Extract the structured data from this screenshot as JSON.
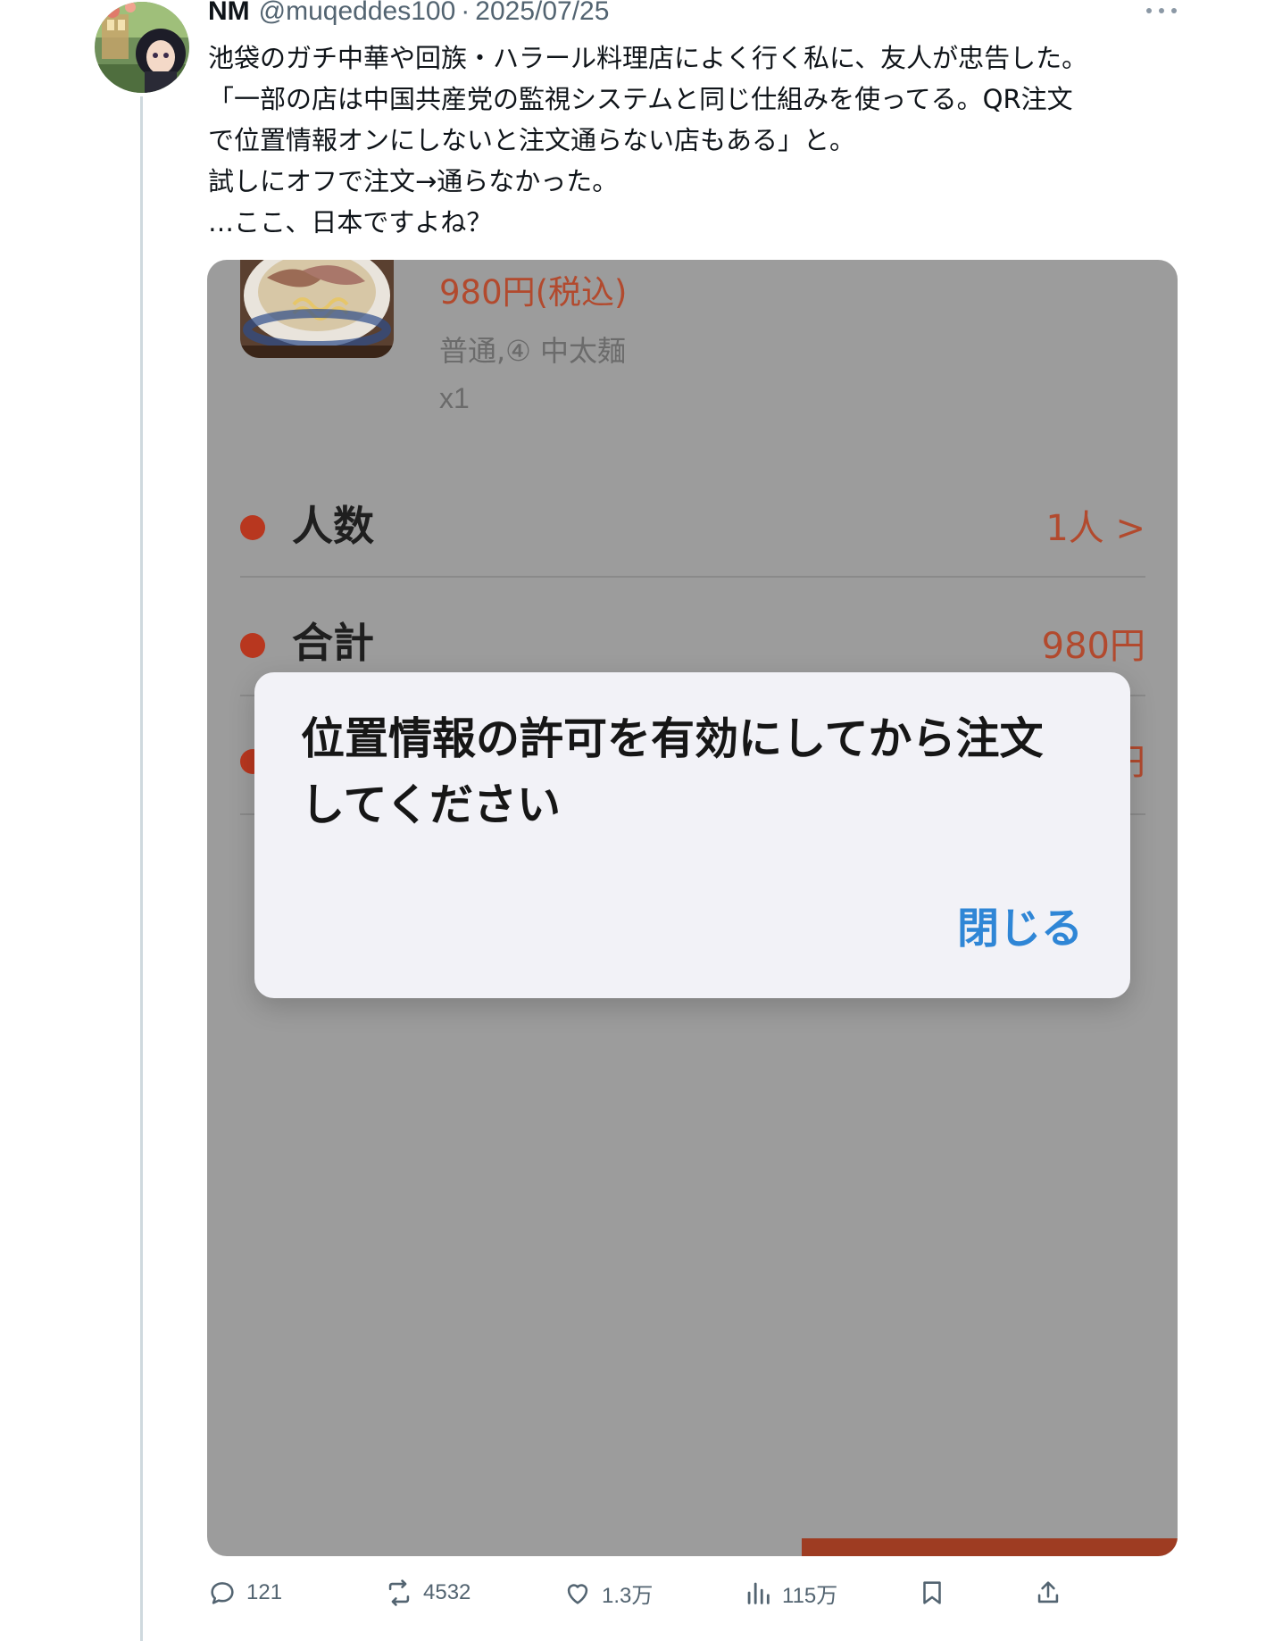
{
  "tweet": {
    "author_name": "NM",
    "handle": "@muqeddes100",
    "separator": "·",
    "date": "2025/07/25",
    "text_lines": [
      "池袋のガチ中華や回族・ハラール料理店によく行く私に、友人が忠告した。",
      "「一部の店は中国共産党の監視システムと同じ仕組みを使ってる。QR注文",
      "で位置情報オンにしないと注文通らない店もある」と。",
      "試しにオフで注文→通らなかった。",
      "…ここ、日本ですよね？"
    ]
  },
  "screenshot": {
    "item_price": "980円(税込)",
    "item_options": "普通,④ 中太麺",
    "item_qty": "x1",
    "rows": [
      {
        "label": "人数",
        "value": "1人 >"
      },
      {
        "label": "合計",
        "value": "980円"
      }
    ],
    "hidden_row_value_fragment": "円",
    "dialog": {
      "message_line1": "位置情報の許可を有効にしてから注文",
      "message_line2": "してください",
      "close_button": "閉じる"
    }
  },
  "actions": {
    "reply_count": "121",
    "retweet_count": "4532",
    "like_count": "1.3万",
    "view_count": "115万"
  },
  "colors": {
    "accent_red": "#b24a2e",
    "dialog_button_blue": "#2f86d6",
    "muted_text": "#536471"
  }
}
